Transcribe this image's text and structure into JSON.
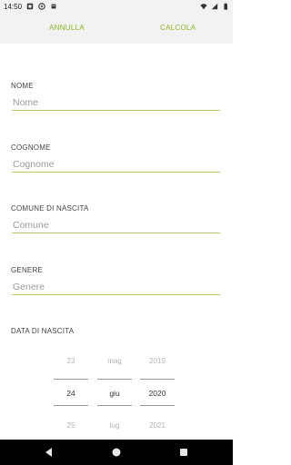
{
  "status_bar": {
    "time": "14:50",
    "left_icons": [
      "sim-card-icon",
      "battery-saver-icon",
      "notification-icon"
    ],
    "right_icons": [
      "wifi-icon",
      "cellular-signal-icon",
      "battery-icon"
    ]
  },
  "toolbar": {
    "cancel_label": "ANNULLA",
    "calculate_label": "CALCOLA",
    "accent_color": "#8bb81f"
  },
  "form": {
    "fields": [
      {
        "label": "NOME",
        "placeholder": "Nome",
        "value": ""
      },
      {
        "label": "COGNOME",
        "placeholder": "Cognome",
        "value": ""
      },
      {
        "label": "COMUNE DI NASCITA",
        "placeholder": "Comune",
        "value": ""
      },
      {
        "label": "GENERE",
        "placeholder": "Genere",
        "value": ""
      }
    ],
    "birth_date": {
      "label": "DATA DI NASCITA",
      "day": {
        "prev": "23",
        "selected": "24",
        "next": "25"
      },
      "month": {
        "prev": "mag",
        "selected": "giu",
        "next": "lug"
      },
      "year": {
        "prev": "2019",
        "selected": "2020",
        "next": "2021"
      }
    }
  },
  "nav_bar": {
    "icons": [
      "back-icon",
      "home-icon",
      "recents-icon"
    ]
  }
}
